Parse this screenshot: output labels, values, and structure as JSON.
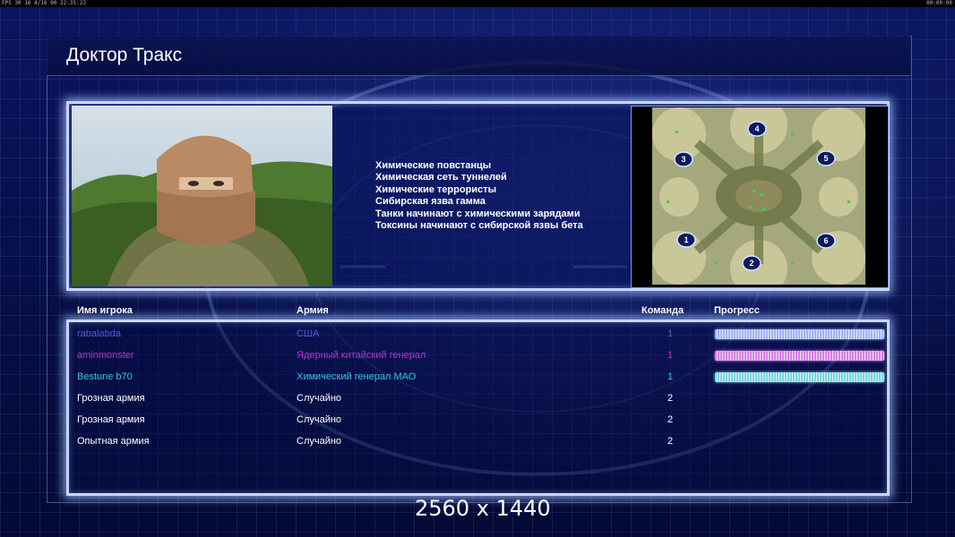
{
  "topbar": {
    "fps_label": "FPS 30",
    "status": "16 4/16 00 22:35:23",
    "clock": "00:00:00"
  },
  "screen": {
    "title": "Доктор Тракс",
    "description_lines": [
      "Химические повстанцы",
      "Химическая сеть туннелей",
      "Химические террористы",
      "Сибирская язва гамма",
      "Танки начинают с химическими зарядами",
      "Токсины начинают с сибирской язвы бета"
    ],
    "minimap_start_positions": [
      "1",
      "2",
      "3",
      "4",
      "5",
      "6"
    ]
  },
  "table": {
    "headers": {
      "name": "Имя игрока",
      "army": "Армия",
      "team": "Команда",
      "progress": "Прогресс"
    },
    "rows": [
      {
        "name": "rabalabda",
        "army": "США",
        "team": "1",
        "color": "#4a5ee0",
        "progress": 1.0,
        "bar_color": "#9fb4ff"
      },
      {
        "name": "aminmonster",
        "army": "Ядерный китайский генерал",
        "team": "1",
        "color": "#c030c8",
        "progress": 1.0,
        "bar_color": "#e07ae8"
      },
      {
        "name": "Bestune b70",
        "army": "Химический генерал МАО",
        "team": "1",
        "color": "#36c6d6",
        "progress": 1.0,
        "bar_color": "#7ad8e0"
      },
      {
        "name": "Грозная армия",
        "army": "Случайно",
        "team": "2",
        "color": "#ffffff",
        "progress": null,
        "bar_color": ""
      },
      {
        "name": "Грозная армия",
        "army": "Случайно",
        "team": "2",
        "color": "#ffffff",
        "progress": null,
        "bar_color": ""
      },
      {
        "name": "Опытная армия",
        "army": "Случайно",
        "team": "2",
        "color": "#ffffff",
        "progress": null,
        "bar_color": ""
      }
    ]
  },
  "resolution_caption": "2560 x 1440"
}
